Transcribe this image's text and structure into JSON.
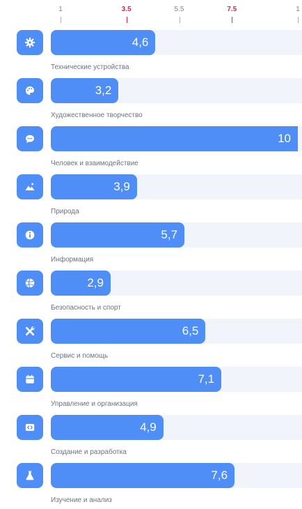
{
  "chart_data": {
    "type": "bar",
    "orientation": "horizontal",
    "xlim": [
      1,
      10
    ],
    "ticks": [
      {
        "value": 1,
        "label": "1",
        "highlight": false
      },
      {
        "value": 3.5,
        "label": "3.5",
        "highlight": true
      },
      {
        "value": 5.5,
        "label": "5.5",
        "highlight": false
      },
      {
        "value": 7.5,
        "label": "7.5",
        "highlight": true
      },
      {
        "value": 10,
        "label": "1",
        "highlight": false
      }
    ],
    "categories": [
      "Технические устройства",
      "Художественное творчество",
      "Человек и взаимодействие",
      "Природа",
      "Информация",
      "Безопасность и спорт",
      "Сервис и помощь",
      "Управление и организация",
      "Создание и разработка",
      "Изучение и анализ"
    ],
    "values": [
      4.6,
      3.2,
      10,
      3.9,
      5.7,
      2.9,
      6.5,
      7.1,
      4.9,
      7.6
    ],
    "value_labels": [
      "4,6",
      "3,2",
      "10",
      "3,9",
      "5,7",
      "2,9",
      "6,5",
      "7,1",
      "4,9",
      "7,6"
    ],
    "icons": [
      "gear-icon",
      "palette-icon",
      "chat-icon",
      "landscape-icon",
      "info-icon",
      "ball-icon",
      "tools-icon",
      "calendar-icon",
      "code-icon",
      "flask-icon"
    ],
    "colors": {
      "bar": "#4f8ef7",
      "track": "#f1f4fb",
      "highlight_tick": "#e3244a"
    }
  }
}
